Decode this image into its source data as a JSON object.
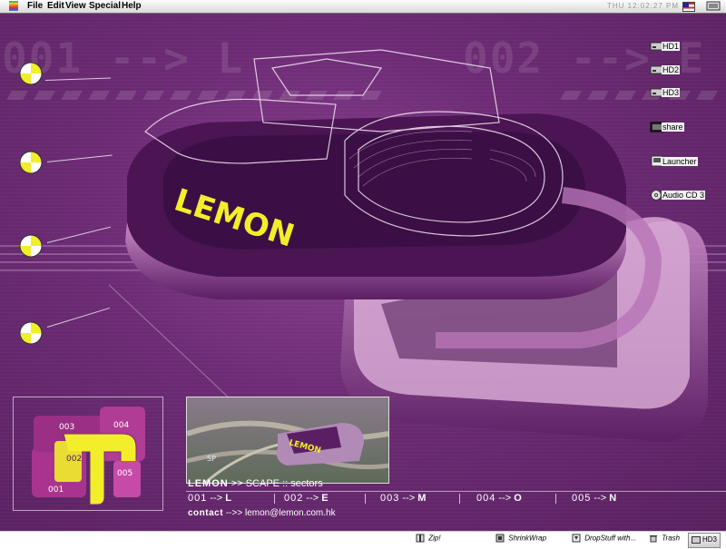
{
  "menubar": {
    "menus": [
      "File",
      "Edit",
      "View",
      "Special",
      "Help"
    ],
    "clock": "THU 12:02:27 PM"
  },
  "backdrop": {
    "sector_code_left": "001 --> L",
    "sector_code_right": "002 --> E",
    "logo_text": "LEMON"
  },
  "desktop_icons": [
    {
      "label": "HD1",
      "icon": "hard-disk-icon"
    },
    {
      "label": "HD2",
      "icon": "hard-disk-icon"
    },
    {
      "label": "HD3",
      "icon": "hard-disk-icon"
    },
    {
      "label": "share",
      "icon": "shared-folder-icon"
    },
    {
      "label": "Launcher",
      "icon": "launcher-icon"
    },
    {
      "label": "Audio CD 3",
      "icon": "cd-icon"
    }
  ],
  "minimap": {
    "labels": [
      "003",
      "004",
      "002",
      "005",
      "001"
    ]
  },
  "photo": {
    "caption": "SP"
  },
  "info": {
    "brand": "LEMON",
    "arrow": ">>",
    "section": "SCAPE :: sectors",
    "sectors": [
      {
        "num": "001",
        "arrow": "-->",
        "letter": "L"
      },
      {
        "num": "002",
        "arrow": "-->",
        "letter": "E"
      },
      {
        "num": "003",
        "arrow": "-->",
        "letter": "M"
      },
      {
        "num": "004",
        "arrow": "-->",
        "letter": "O"
      },
      {
        "num": "005",
        "arrow": "-->",
        "letter": "N"
      }
    ],
    "contact_label": "contact",
    "contact_arrow": "-->>",
    "email": "lemon@lemon.com.hk"
  },
  "bottombar": {
    "items": [
      {
        "label": "Zip!",
        "icon": "zip-icon"
      },
      {
        "label": "ShrinkWrap",
        "icon": "shrinkwrap-icon"
      },
      {
        "label": "DropStuff with...",
        "icon": "dropstuff-icon"
      },
      {
        "label": "Trash",
        "icon": "trash-icon"
      }
    ],
    "tab": "HD3"
  },
  "colors": {
    "background": "#6a2a72",
    "accent_yellow": "#f2ee2a",
    "logo_pink": "#c98bc4",
    "logo_dark": "#3a1040"
  }
}
